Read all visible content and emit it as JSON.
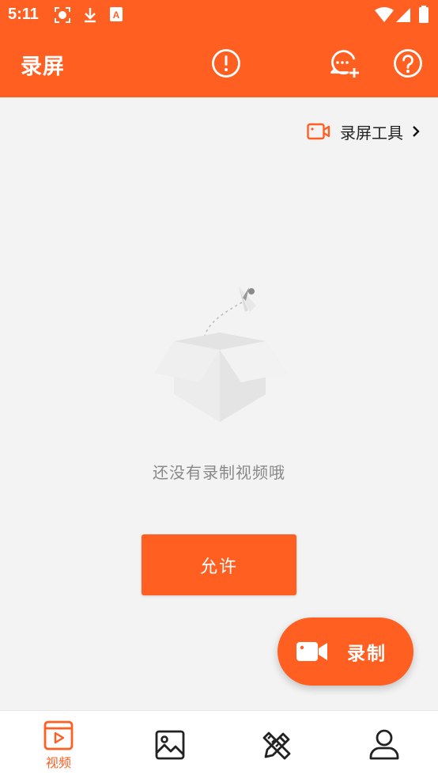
{
  "status_bar": {
    "time": "5:11",
    "icons": [
      "screen-record-icon",
      "download-icon",
      "text-a-icon",
      "wifi-icon",
      "signal-icon",
      "battery-icon"
    ]
  },
  "app_bar": {
    "title": "录屏",
    "actions": [
      "alert-circle-icon",
      "chat-add-icon",
      "help-icon"
    ]
  },
  "tools_link": {
    "label": "录屏工具"
  },
  "empty_state": {
    "message": "还没有录制视频哦"
  },
  "allow_button": {
    "label": "允许"
  },
  "record_fab": {
    "label": "录制"
  },
  "bottom_nav": {
    "items": [
      {
        "icon": "video-tab-icon",
        "label": "视频",
        "active": true
      },
      {
        "icon": "image-tab-icon",
        "label": "",
        "active": false
      },
      {
        "icon": "tools-tab-icon",
        "label": "",
        "active": false
      },
      {
        "icon": "profile-tab-icon",
        "label": "",
        "active": false
      }
    ]
  },
  "colors": {
    "accent": "#ff5f21",
    "background": "#f3f3f3",
    "nav_icon": "#222222"
  }
}
